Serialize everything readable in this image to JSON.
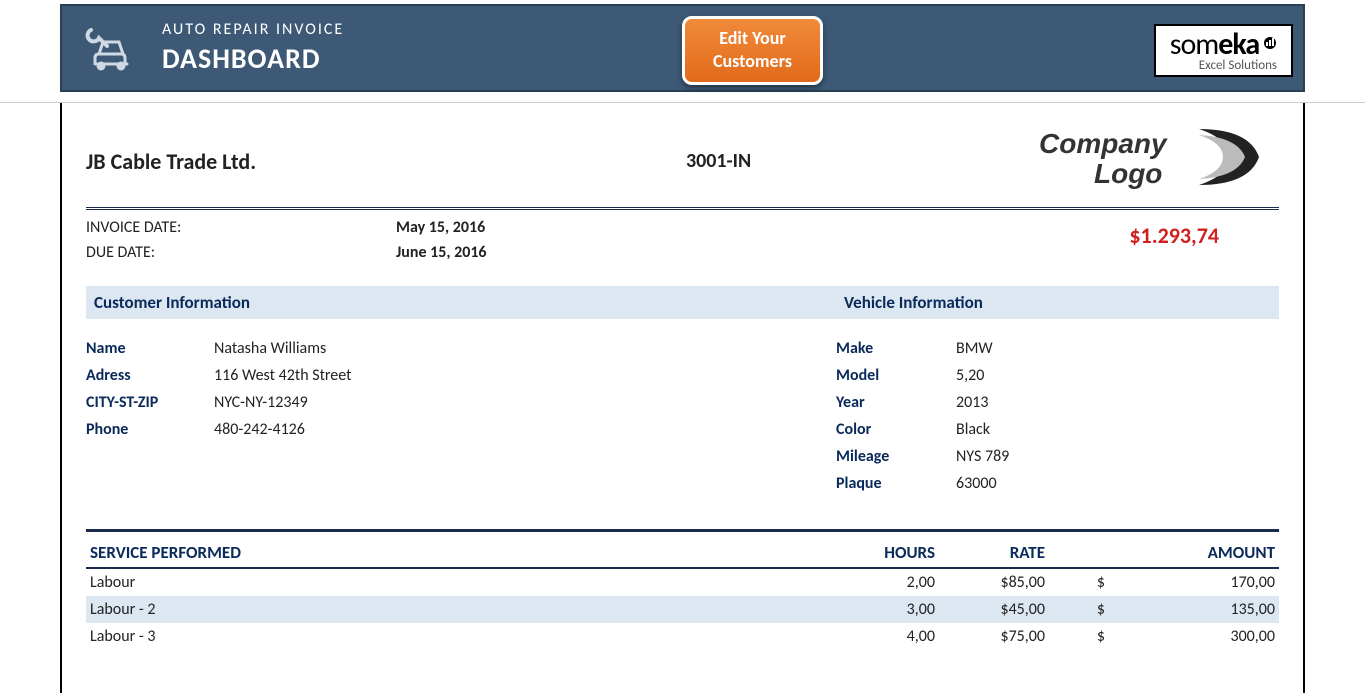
{
  "topbar": {
    "subtitle": "AUTO REPAIR INVOICE",
    "title": "DASHBOARD",
    "edit_btn_line1": "Edit Your",
    "edit_btn_line2": "Customers",
    "someka_brand_light": "som",
    "someka_brand_bold": "eka",
    "someka_tag": "Excel Solutions"
  },
  "invoice": {
    "company_name": "JB Cable Trade Ltd.",
    "invoice_number": "3001-IN",
    "logo_text1": "Company",
    "logo_text2": "Logo",
    "dates": {
      "invoice_date_label": "INVOICE DATE:",
      "invoice_date_value": "May 15, 2016",
      "due_date_label": "DUE DATE:",
      "due_date_value": "June 15, 2016"
    },
    "total": "$1.293,74"
  },
  "sections": {
    "customer_title": "Customer Information",
    "vehicle_title": "Vehicle Information"
  },
  "customer": {
    "name_label": "Name",
    "name_value": "Natasha Williams",
    "address_label": "Adress",
    "address_value": "116 West 42th Street",
    "csz_label": "CITY-ST-ZIP",
    "csz_value": "NYC-NY-12349",
    "phone_label": "Phone",
    "phone_value": "480-242-4126"
  },
  "vehicle": {
    "make_label": "Make",
    "make_value": "BMW",
    "model_label": "Model",
    "model_value": "5,20",
    "year_label": "Year",
    "year_value": "2013",
    "color_label": "Color",
    "color_value": "Black",
    "mileage_label": "Mileage",
    "mileage_value": "NYS 789",
    "plaque_label": "Plaque",
    "plaque_value": "63000"
  },
  "service": {
    "head_service": "SERVICE PERFORMED",
    "head_hours": "HOURS",
    "head_rate": "RATE",
    "head_amount": "AMOUNT",
    "currency": "$",
    "rows": [
      {
        "name": "Labour",
        "hours": "2,00",
        "rate": "$85,00",
        "amount": "170,00"
      },
      {
        "name": "Labour - 2",
        "hours": "3,00",
        "rate": "$45,00",
        "amount": "135,00"
      },
      {
        "name": "Labour - 3",
        "hours": "4,00",
        "rate": "$75,00",
        "amount": "300,00"
      }
    ]
  }
}
